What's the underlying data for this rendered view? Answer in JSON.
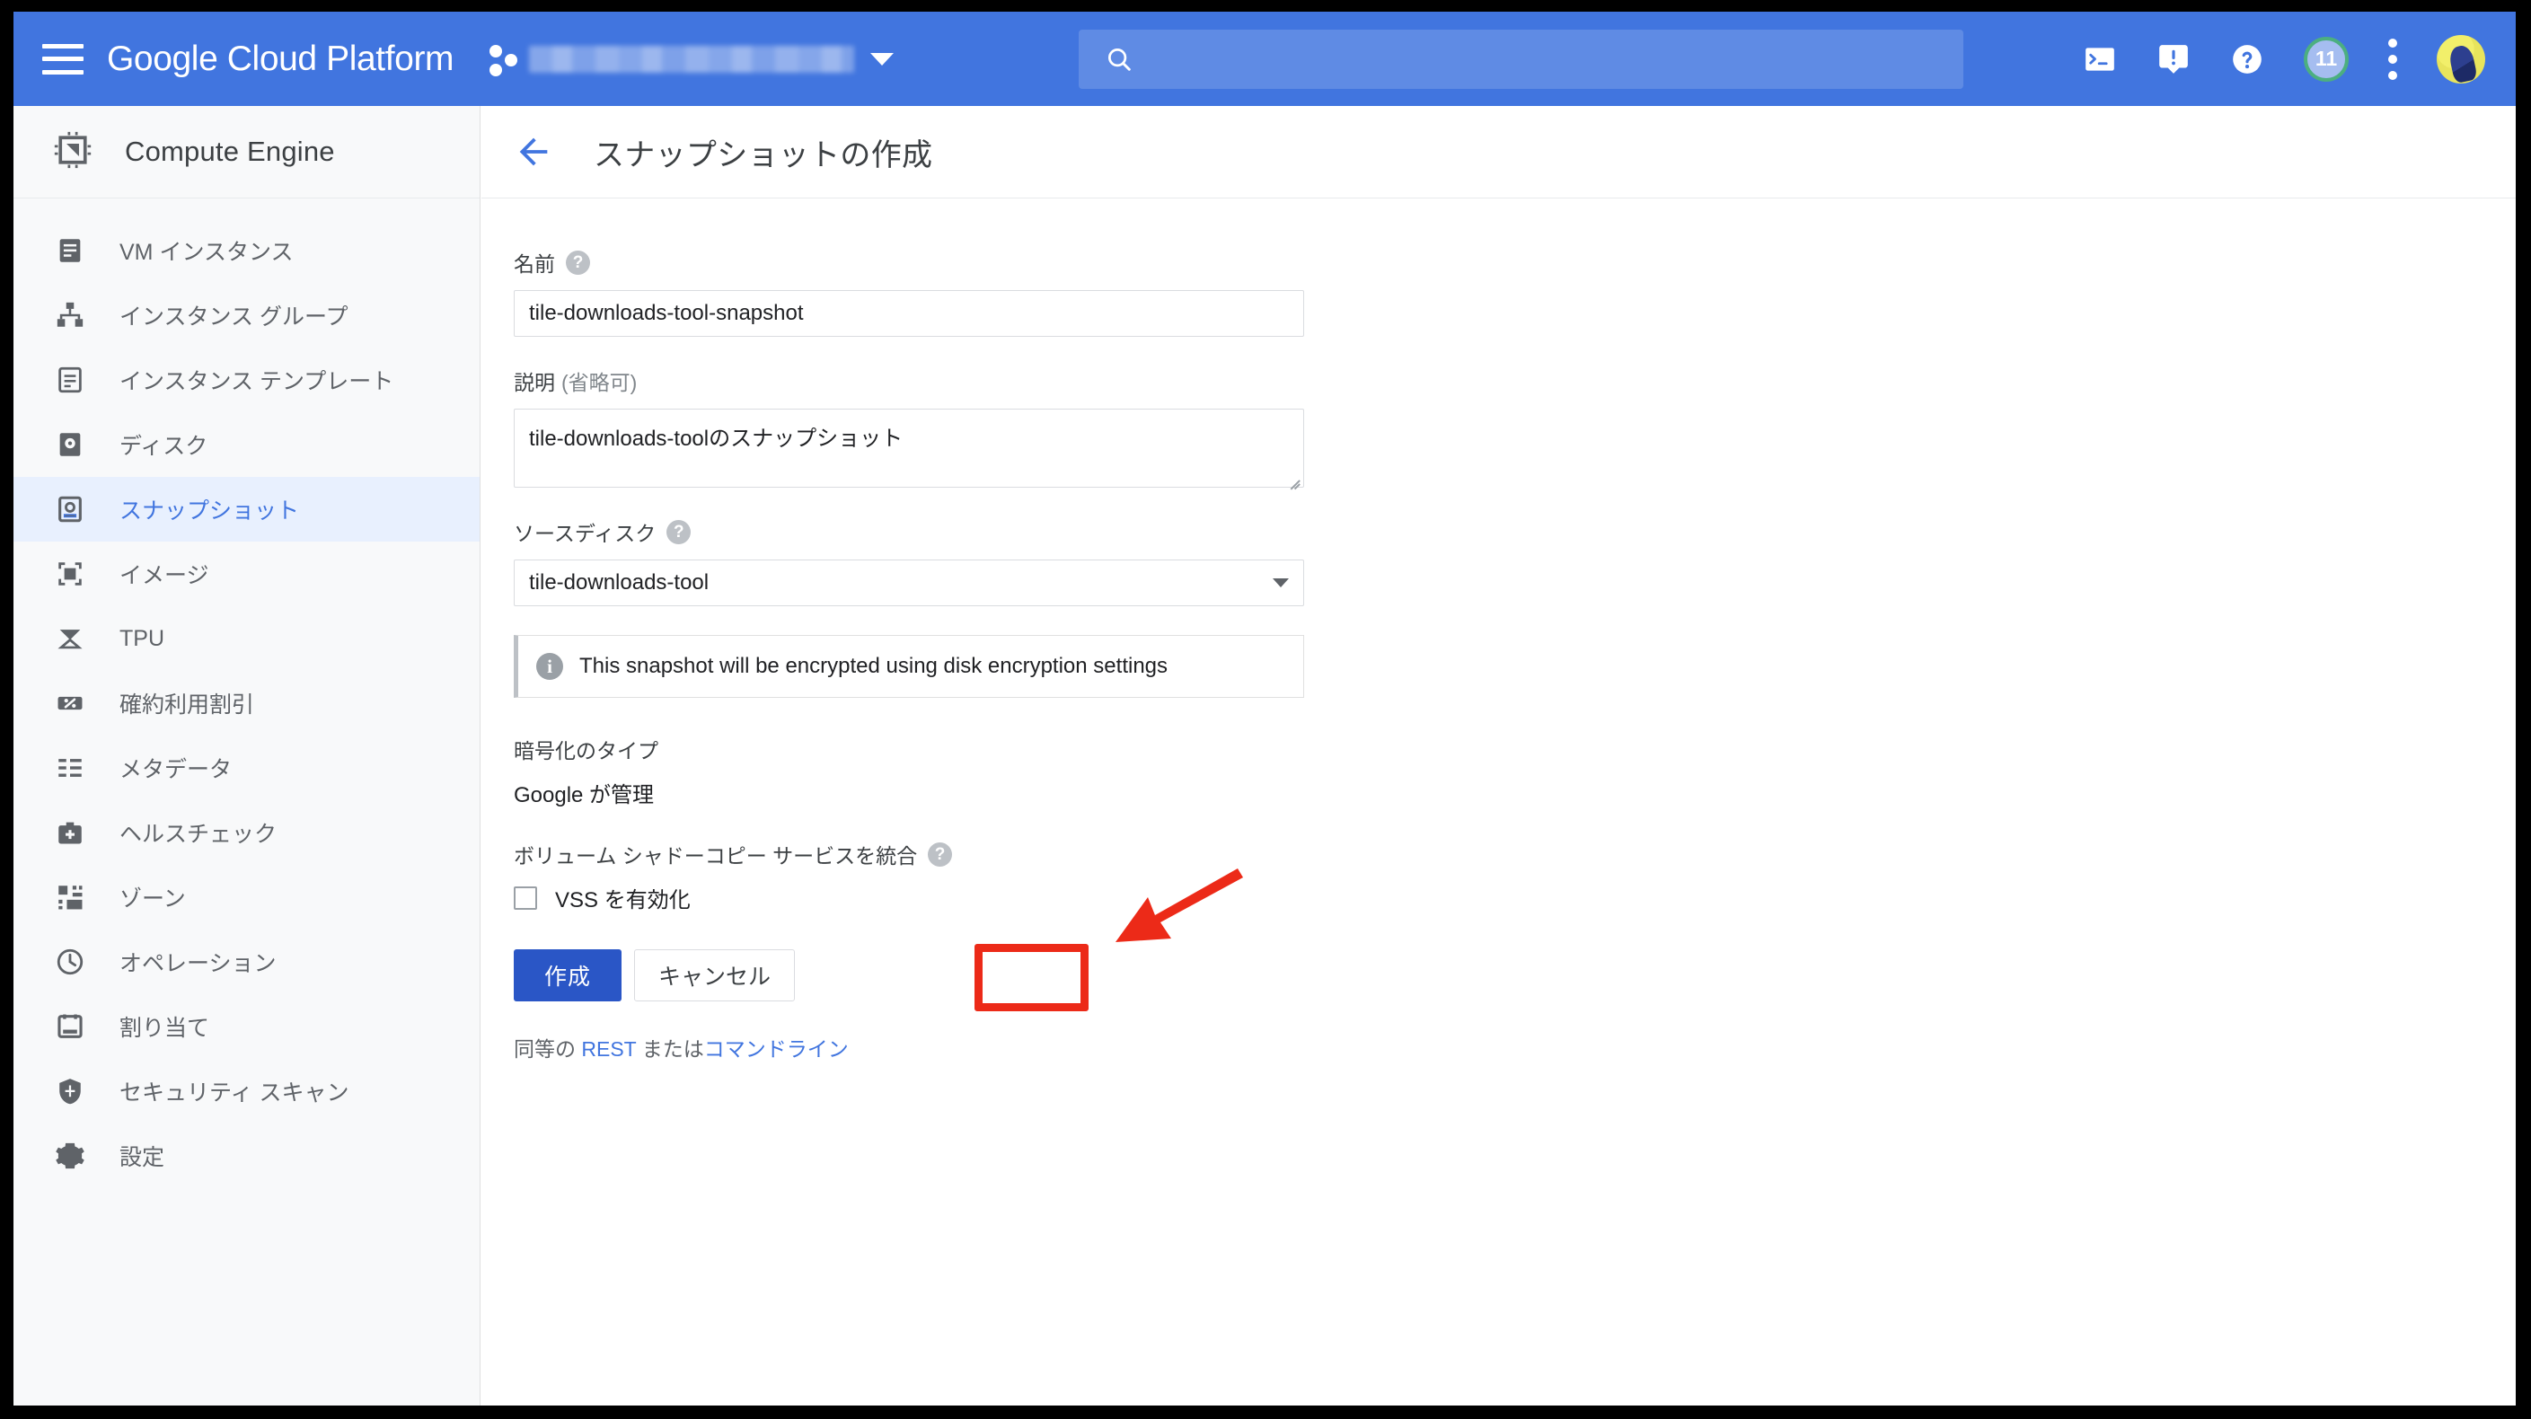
{
  "topbar": {
    "brand": "Google Cloud Platform",
    "menu_icon": "hamburger-icon",
    "project_selector_icon": "project-dots-icon",
    "project_name": "",
    "search_placeholder": "",
    "search_value": "",
    "search_icon": "search-icon",
    "cloud_shell_icon": "cloud-shell-icon",
    "feedback_icon": "feedback-icon",
    "help_icon": "help-icon",
    "notifications_count": "11",
    "kebab_icon": "more-vert-icon",
    "avatar_icon": "user-avatar",
    "bg_color": "#4175df"
  },
  "sidebar": {
    "product_title": "Compute Engine",
    "product_icon": "cpu-chip-icon",
    "selected_color": "#4175df",
    "selected_bg": "#e8f0fe",
    "items": [
      {
        "label": "VM インスタンス",
        "icon": "vm-instance-icon",
        "selected": false
      },
      {
        "label": "インスタンス グループ",
        "icon": "instance-group-icon",
        "selected": false
      },
      {
        "label": "インスタンス テンプレート",
        "icon": "instance-template-icon",
        "selected": false
      },
      {
        "label": "ディスク",
        "icon": "disk-icon",
        "selected": false
      },
      {
        "label": "スナップショット",
        "icon": "snapshot-icon",
        "selected": true
      },
      {
        "label": "イメージ",
        "icon": "image-icon",
        "selected": false
      },
      {
        "label": "TPU",
        "icon": "tpu-icon",
        "selected": false
      },
      {
        "label": "確約利用割引",
        "icon": "percent-discount-icon",
        "selected": false
      },
      {
        "label": "メタデータ",
        "icon": "metadata-list-icon",
        "selected": false
      },
      {
        "label": "ヘルスチェック",
        "icon": "health-check-icon",
        "selected": false
      },
      {
        "label": "ゾーン",
        "icon": "zone-icon",
        "selected": false
      },
      {
        "label": "オペレーション",
        "icon": "clock-operations-icon",
        "selected": false
      },
      {
        "label": "割り当て",
        "icon": "quota-icon",
        "selected": false
      },
      {
        "label": "セキュリティ スキャン",
        "icon": "shield-security-icon",
        "selected": false
      },
      {
        "label": "設定",
        "icon": "gear-icon",
        "selected": false
      }
    ]
  },
  "page": {
    "back_icon": "back-arrow-icon",
    "title": "スナップショットの作成"
  },
  "form": {
    "name_label": "名前",
    "name_help_icon": "help-circle-icon",
    "name_value": "tile-downloads-tool-snapshot",
    "name_placeholder": "",
    "description_label": "説明",
    "description_optional": "(省略可)",
    "description_value": "tile-downloads-toolのスナップショット",
    "description_placeholder": "",
    "source_disk_label": "ソースディスク",
    "source_disk_help_icon": "help-circle-icon",
    "source_disk_value": "tile-downloads-tool",
    "info_icon": "info-circle-icon",
    "info_message": "This snapshot will be encrypted using disk encryption settings",
    "encryption_type_label": "暗号化のタイプ",
    "encryption_type_value": "Google が管理",
    "vss_group_label": "ボリューム シャドーコピー サービスを統合",
    "vss_help_icon": "help-circle-icon",
    "vss_checkbox_label": "VSS を有効化",
    "vss_checked": false
  },
  "actions": {
    "create_label": "作成",
    "cancel_label": "キャンセル",
    "equivalent_prefix": "同等の ",
    "rest_link": "REST",
    "equivalent_middle": " または",
    "commandline_link": "コマンドライン",
    "primary_color": "#2a56c6"
  },
  "annotations": {
    "highlight_color": "#ec2a18",
    "box_target": "create-button",
    "arrow_target": "vss-checkbox"
  }
}
